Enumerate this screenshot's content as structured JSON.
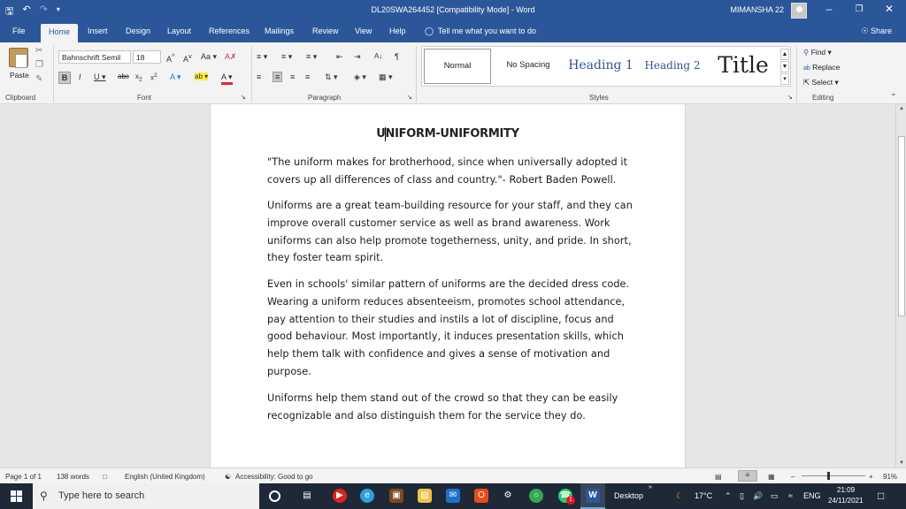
{
  "titlebar": {
    "doc_title": "DL20SWA264452 [Compatibility Mode] - Word",
    "user": "MIMANSHA 22"
  },
  "tabs": [
    "File",
    "Home",
    "Insert",
    "Design",
    "Layout",
    "References",
    "Mailings",
    "Review",
    "View",
    "Help"
  ],
  "tellme": "Tell me what you want to do",
  "share": "Share",
  "ribbon": {
    "paste": "Paste",
    "font_name": "Bahnschrift Semil",
    "font_size": "18",
    "groups": {
      "clipboard": "Clipboard",
      "font": "Font",
      "paragraph": "Paragraph",
      "styles": "Styles",
      "editing": "Editing"
    },
    "styles": [
      "Normal",
      "No Spacing",
      "Heading 1",
      "Heading 2",
      "Title"
    ],
    "editing": {
      "find": "Find",
      "replace": "Replace",
      "select": "Select"
    }
  },
  "document": {
    "heading": "UNIFORM-UNIFORMITY",
    "paragraphs": [
      "\"The uniform makes for brotherhood, since when universally adopted it covers up all differences of class and country.\"- Robert Baden Powell.",
      "Uniforms are a great team-building resource for your staff, and they can improve overall customer service as well as brand awareness. Work uniforms can also help promote togetherness, unity, and pride. In short, they foster team spirit.",
      "Even in schools' similar pattern of uniforms are the decided dress code. Wearing a uniform reduces absenteeism, promotes school attendance, pay attention to their studies and instils a lot of discipline, focus and good behaviour. Most importantly, it induces presentation skills, which help them talk with confidence and gives a sense of motivation and purpose.",
      "Uniforms help them stand out of the crowd so that they can be easily recognizable and also distinguish them for the service they do."
    ]
  },
  "status": {
    "page": "Page 1 of 1",
    "words": "138 words",
    "language": "English (United Kingdom)",
    "accessibility": "Accessibility: Good to go",
    "zoom": "91%"
  },
  "taskbar": {
    "search_placeholder": "Type here to search",
    "desktop": "Desktop",
    "temperature": "17°C",
    "lang": "ENG",
    "time": "21:09",
    "date": "24/11/2021",
    "whatsapp_badge": "1"
  }
}
